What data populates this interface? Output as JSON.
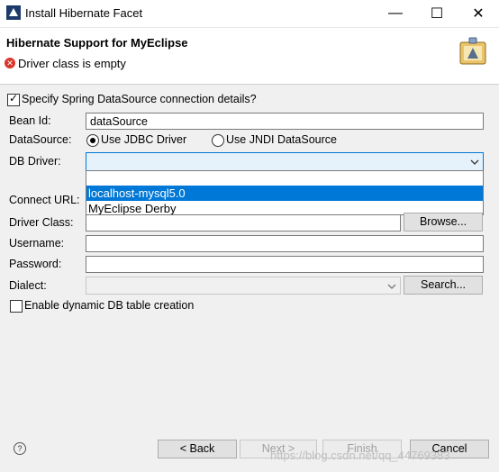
{
  "window": {
    "title": "Install Hibernate Facet",
    "minimize_glyph": "—",
    "maximize_glyph": "☐",
    "close_glyph": "✕"
  },
  "header": {
    "title": "Hibernate Support for MyEclipse",
    "error_message": "Driver class is empty"
  },
  "form": {
    "spring_checkbox_label": "Specify Spring DataSource connection details?",
    "spring_checked": true,
    "bean_id_label": "Bean Id:",
    "bean_id_value": "dataSource",
    "datasource_label": "DataSource:",
    "radio_jdbc_label": "Use JDBC Driver",
    "radio_jndi_label": "Use JNDI DataSource",
    "radio_selected": "jdbc",
    "db_driver_label": "DB Driver:",
    "db_driver_value": "",
    "db_driver_options": [
      "localhost-mysql5.0",
      "MyEclipse Derby"
    ],
    "db_driver_highlighted": "localhost-mysql5.0",
    "connect_url_label": "Connect URL:",
    "driver_class_label": "Driver Class:",
    "browse_label": "Browse...",
    "username_label": "Username:",
    "password_label": "Password:",
    "dialect_label": "Dialect:",
    "search_label": "Search...",
    "dynamic_table_label": "Enable dynamic DB table creation",
    "dynamic_table_checked": false
  },
  "footer": {
    "back_label": "< Back",
    "next_label": "Next >",
    "finish_label": "Finish",
    "cancel_label": "Cancel"
  },
  "watermark": "https://blog.csdn.net/qq_44769383",
  "colors": {
    "accent": "#0078d7",
    "error": "#d8372b",
    "window_bg": "#f0f0f0"
  }
}
